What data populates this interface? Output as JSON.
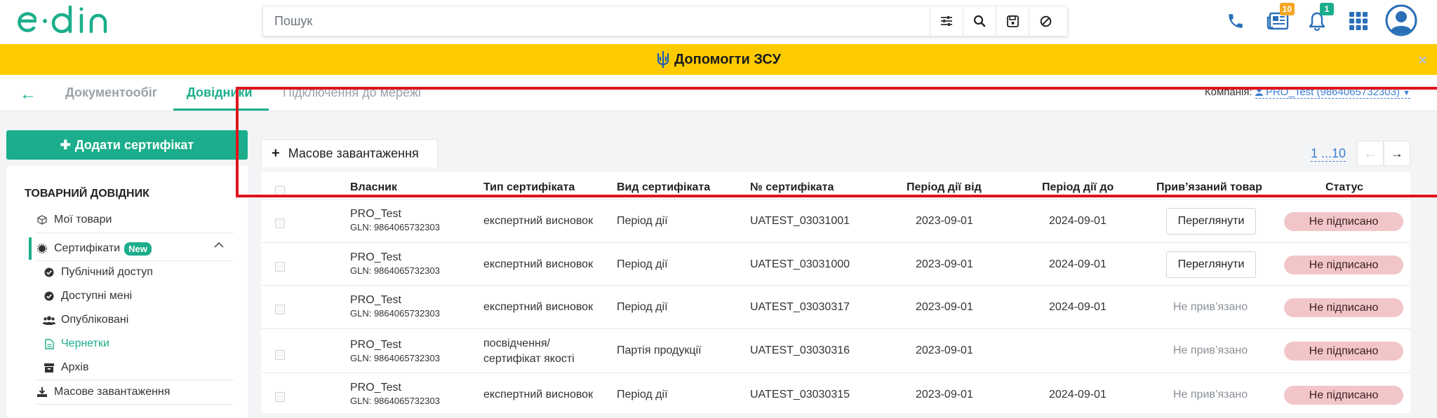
{
  "brand": "edin",
  "search": {
    "placeholder": "Пошук"
  },
  "header": {
    "docs_badge": "10",
    "bell_badge": "1"
  },
  "banner": {
    "text": "Допомогти ЗСУ",
    "close": "×"
  },
  "nav": {
    "back": "←",
    "tabs": [
      "Документообіг",
      "Довідники",
      "Підключення до мережі"
    ],
    "company_label": "Компанія:",
    "company_value": "PRO_Test (9864065732303)"
  },
  "sidebar": {
    "add_button": "Додати сертифікат",
    "title": "ТОВАРНИЙ ДОВІДНИК",
    "items": {
      "my_goods": "Мої товари",
      "certificates": "Сертифікати",
      "new_badge": "New",
      "public_access": "Публічний доступ",
      "available_to_me": "Доступні мені",
      "published": "Опубліковані",
      "drafts": "Чернетки",
      "archive": "Архів",
      "bulk_upload": "Масове завантаження"
    }
  },
  "toolbar": {
    "bulk_upload": "Масове завантаження",
    "pages": "1 ...10"
  },
  "table": {
    "headers": [
      "Власник",
      "Тип сертифіката",
      "Вид сертифіката",
      "№ сертифіката",
      "Період дії від",
      "Період дії до",
      "Прив’язаний товар",
      "Статус"
    ],
    "rows": [
      {
        "owner": "PRO_Test",
        "gln": "GLN: 9864065732303",
        "type": "експертний висновок",
        "type2": "",
        "kind": "Період дії",
        "number": "UATEST_03031001",
        "from": "2023-09-01",
        "to": "2024-09-01",
        "linked": "Переглянути",
        "linked_is_button": true,
        "status": "Не підписано"
      },
      {
        "owner": "PRO_Test",
        "gln": "GLN: 9864065732303",
        "type": "експертний висновок",
        "type2": "",
        "kind": "Період дії",
        "number": "UATEST_03031000",
        "from": "2023-09-01",
        "to": "2024-09-01",
        "linked": "Переглянути",
        "linked_is_button": true,
        "status": "Не підписано"
      },
      {
        "owner": "PRO_Test",
        "gln": "GLN: 9864065732303",
        "type": "експертний висновок",
        "type2": "",
        "kind": "Період дії",
        "number": "UATEST_03030317",
        "from": "2023-09-01",
        "to": "2024-09-01",
        "linked": "Не прив’язано",
        "linked_is_button": false,
        "status": "Не підписано"
      },
      {
        "owner": "PRO_Test",
        "gln": "GLN: 9864065732303",
        "type": "посвідчення/",
        "type2": "сертифікат якості",
        "kind": "Партія продукції",
        "number": "UATEST_03030316",
        "from": "2023-09-01",
        "to": "",
        "linked": "Не прив’язано",
        "linked_is_button": false,
        "status": "Не підписано"
      },
      {
        "owner": "PRO_Test",
        "gln": "GLN: 9864065732303",
        "type": "експертний висновок",
        "type2": "",
        "kind": "Період дії",
        "number": "UATEST_03030315",
        "from": "2023-09-01",
        "to": "2024-09-01",
        "linked": "Не прив’язано",
        "linked_is_button": false,
        "status": "Не підписано"
      }
    ]
  },
  "colors": {
    "accent": "#1cae8c",
    "banner": "#fecb00",
    "status_bg": "#f2c6c9",
    "link": "#3d7fd3",
    "highlight_box": "#e0141d"
  }
}
